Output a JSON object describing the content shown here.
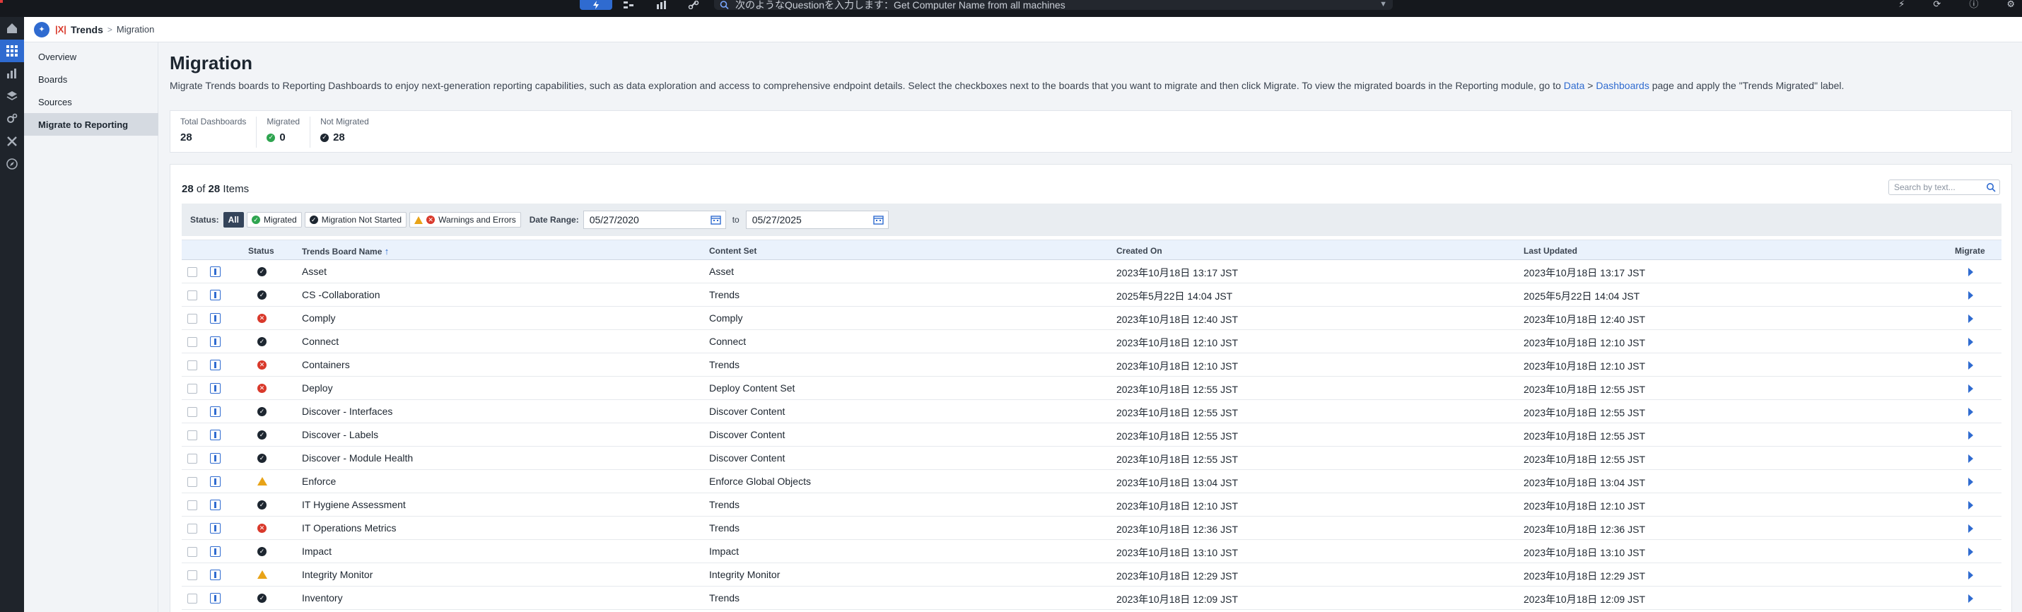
{
  "topbar": {
    "query_placeholder": "次のようなQuestionを入力します：Get Computer Name from all machines"
  },
  "app": {
    "name": "Trends",
    "breadcrumb": "Migration"
  },
  "nav": {
    "items": [
      {
        "label": "Overview"
      },
      {
        "label": "Boards"
      },
      {
        "label": "Sources"
      },
      {
        "label": "Migrate to Reporting"
      }
    ]
  },
  "page": {
    "title": "Migration",
    "desc_pre": "Migrate Trends boards to Reporting Dashboards to enjoy next-generation reporting capabilities, such as data exploration and access to comprehensive endpoint details. Select the checkboxes next to the boards that you want to migrate and then click Migrate. To view the migrated boards in the Reporting module, go to ",
    "desc_link_data": "Data",
    "desc_sep": " > ",
    "desc_link_dash": "Dashboards",
    "desc_post": " page and apply the \"Trends Migrated\" label."
  },
  "summary": {
    "total_label": "Total Dashboards",
    "total_value": "28",
    "migrated_label": "Migrated",
    "migrated_value": "0",
    "not_migrated_label": "Not Migrated",
    "not_migrated_value": "28"
  },
  "list": {
    "shown": "28",
    "of": "of",
    "total": "28",
    "items_label": "Items",
    "search_placeholder": "Search by text..."
  },
  "filters": {
    "status_label": "Status:",
    "all": "All",
    "migrated": "Migrated",
    "not_started": "Migration Not Started",
    "warnings": "Warnings and Errors",
    "date_range_label": "Date Range:",
    "from": "05/27/2020",
    "to_label": "to",
    "to": "05/27/2025"
  },
  "table": {
    "headers": {
      "status": "Status",
      "name": "Trends Board Name",
      "sort_indicator": "↑",
      "content_set": "Content Set",
      "created": "Created On",
      "updated": "Last Updated",
      "migrate": "Migrate"
    },
    "rows": [
      {
        "status": "not-started",
        "name": "Asset",
        "content_set": "Asset",
        "created": "2023年10月18日 13:17 JST",
        "updated": "2023年10月18日 13:17 JST"
      },
      {
        "status": "not-started",
        "name": "CS -Collaboration",
        "content_set": "Trends",
        "created": "2025年5月22日 14:04 JST",
        "updated": "2025年5月22日 14:04 JST"
      },
      {
        "status": "error",
        "name": "Comply",
        "content_set": "Comply",
        "created": "2023年10月18日 12:40 JST",
        "updated": "2023年10月18日 12:40 JST"
      },
      {
        "status": "not-started",
        "name": "Connect",
        "content_set": "Connect",
        "created": "2023年10月18日 12:10 JST",
        "updated": "2023年10月18日 12:10 JST"
      },
      {
        "status": "error",
        "name": "Containers",
        "content_set": "Trends",
        "created": "2023年10月18日 12:10 JST",
        "updated": "2023年10月18日 12:10 JST"
      },
      {
        "status": "error",
        "name": "Deploy",
        "content_set": "Deploy Content Set",
        "created": "2023年10月18日 12:55 JST",
        "updated": "2023年10月18日 12:55 JST"
      },
      {
        "status": "not-started",
        "name": "Discover - Interfaces",
        "content_set": "Discover Content",
        "created": "2023年10月18日 12:55 JST",
        "updated": "2023年10月18日 12:55 JST"
      },
      {
        "status": "not-started",
        "name": "Discover - Labels",
        "content_set": "Discover Content",
        "created": "2023年10月18日 12:55 JST",
        "updated": "2023年10月18日 12:55 JST"
      },
      {
        "status": "not-started",
        "name": "Discover - Module Health",
        "content_set": "Discover Content",
        "created": "2023年10月18日 12:55 JST",
        "updated": "2023年10月18日 12:55 JST"
      },
      {
        "status": "warning",
        "name": "Enforce",
        "content_set": "Enforce Global Objects",
        "created": "2023年10月18日 13:04 JST",
        "updated": "2023年10月18日 13:04 JST"
      },
      {
        "status": "not-started",
        "name": "IT Hygiene Assessment",
        "content_set": "Trends",
        "created": "2023年10月18日 12:10 JST",
        "updated": "2023年10月18日 12:10 JST"
      },
      {
        "status": "error",
        "name": "IT Operations Metrics",
        "content_set": "Trends",
        "created": "2023年10月18日 12:36 JST",
        "updated": "2023年10月18日 12:36 JST"
      },
      {
        "status": "not-started",
        "name": "Impact",
        "content_set": "Impact",
        "created": "2023年10月18日 13:10 JST",
        "updated": "2023年10月18日 13:10 JST"
      },
      {
        "status": "warning",
        "name": "Integrity Monitor",
        "content_set": "Integrity Monitor",
        "created": "2023年10月18日 12:29 JST",
        "updated": "2023年10月18日 12:29 JST"
      },
      {
        "status": "not-started",
        "name": "Inventory",
        "content_set": "Trends",
        "created": "2023年10月18日 12:09 JST",
        "updated": "2023年10月18日 12:09 JST"
      }
    ]
  },
  "colors": {
    "accent": "#2f6bd0",
    "ok": "#2ea44f",
    "error": "#d9392b",
    "warning": "#e8a317"
  }
}
